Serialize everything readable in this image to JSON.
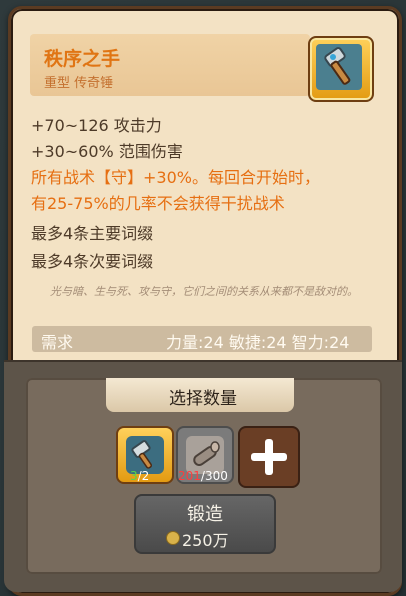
{
  "item": {
    "name": "秩序之手",
    "type": "重型 传奇锤",
    "stats": [
      "+70~126 攻击力",
      "+30~60% 范围伤害",
      "所有战术【守】+30%。每回合开始时，",
      "有25-75%的几率不会获得干扰战术",
      "最多4条主要词缀",
      "最多4条次要词缀"
    ],
    "flavor": "光与暗、生与死、攻与守，它们之间的关系从来都不是敌对的。",
    "requirement_label": "需求",
    "requirements": "力量:24 敏捷:24 智力:24"
  },
  "forge": {
    "quantity_title": "选择数量",
    "materials": [
      {
        "name": "hammer-material",
        "have": "3",
        "need": "/2",
        "icon": "hammer-icon"
      },
      {
        "name": "log-material",
        "have": "201",
        "need": "/300",
        "icon": "log-icon"
      }
    ],
    "add_icon": "plus-icon",
    "button_label": "锻造",
    "cost": "250万",
    "cost_icon": "coin-icon"
  },
  "colors": {
    "title": "#e07514",
    "effect": "#e66f12",
    "panel": "#f3e2c4",
    "enough": "#58d64a",
    "insufficient": "#ff3d3d"
  }
}
